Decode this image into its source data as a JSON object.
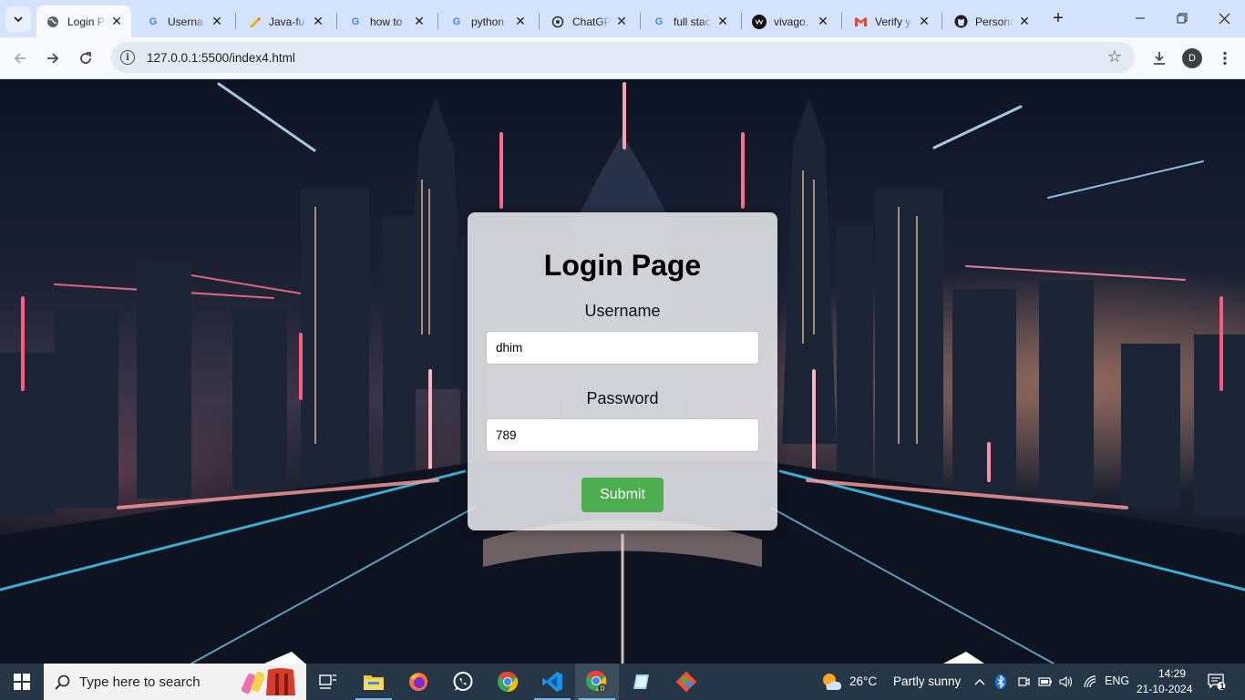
{
  "browser": {
    "tabs": [
      {
        "title": "Login P",
        "icon": "globe-icon",
        "active": true
      },
      {
        "title": "Userna",
        "icon": "google-icon"
      },
      {
        "title": "Java-fu",
        "icon": "pen-icon"
      },
      {
        "title": "how to",
        "icon": "google-icon"
      },
      {
        "title": "python",
        "icon": "google-icon"
      },
      {
        "title": "ChatGP",
        "icon": "chatgpt-icon"
      },
      {
        "title": "full stac",
        "icon": "google-icon"
      },
      {
        "title": "vivago.",
        "icon": "vivago-icon"
      },
      {
        "title": "Verify y",
        "icon": "gmail-icon"
      },
      {
        "title": "Persona",
        "icon": "github-icon"
      }
    ],
    "address_bar": {
      "url": "127.0.0.1:5500/index4.html"
    },
    "profile_initial": "D"
  },
  "page": {
    "title": "Login Page",
    "username_label": "Username",
    "username_value": "dhim",
    "password_label": "Password",
    "password_value": "789",
    "submit_label": "Submit"
  },
  "taskbar": {
    "search_placeholder": "Type here to search",
    "apps": [
      "task-view",
      "file-explorer",
      "firefox",
      "whatsapp",
      "chrome",
      "vscode",
      "chrome-profile",
      "notepad",
      "git"
    ],
    "weather": {
      "temp": "26°C",
      "condition": "Partly sunny"
    },
    "language": "ENG",
    "time": "14:29",
    "date": "21-10-2024",
    "notification_count": "1"
  }
}
